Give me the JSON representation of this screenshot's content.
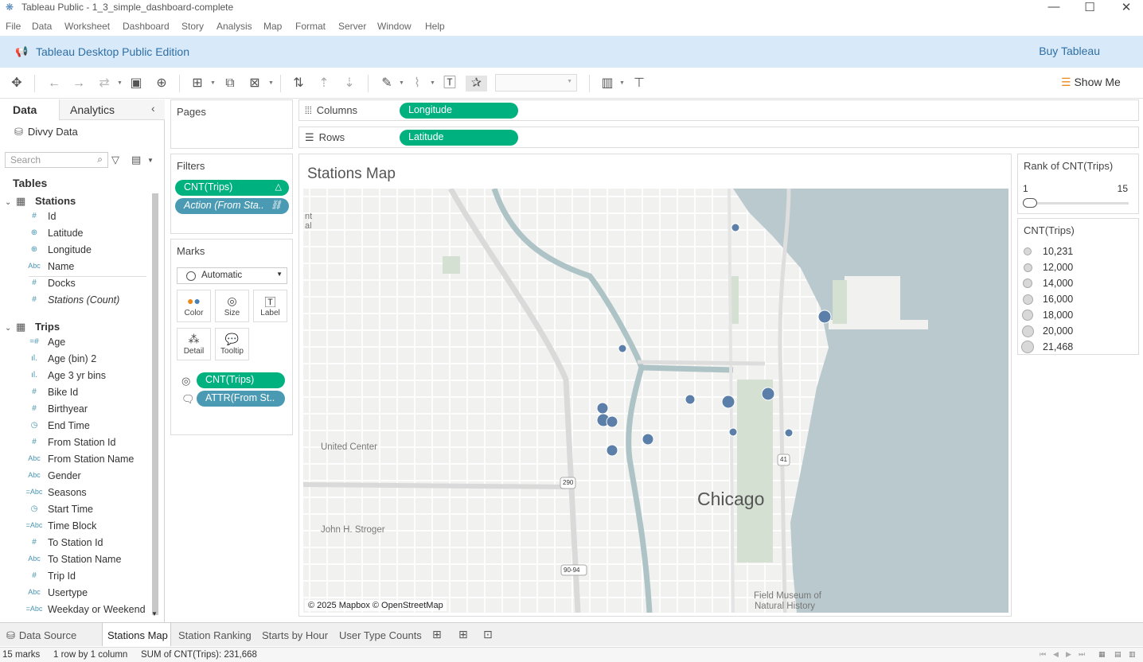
{
  "window": {
    "title": "Tableau Public - 1_3_simple_dashboard-complete",
    "min": "—",
    "max": "☐",
    "close": "✕"
  },
  "menu": [
    "File",
    "Data",
    "Worksheet",
    "Dashboard",
    "Story",
    "Analysis",
    "Map",
    "Format",
    "Server",
    "Window",
    "Help"
  ],
  "banner": {
    "title": "Tableau Desktop Public Edition",
    "buy": "Buy Tableau"
  },
  "toolbar": {
    "show_me": "Show Me"
  },
  "left_panel": {
    "tab_data": "Data",
    "tab_analytics": "Analytics",
    "datasource": "Divvy Data",
    "search_placeholder": "Search",
    "tables_heading": "Tables",
    "groups": [
      {
        "name": "Stations",
        "fields": [
          {
            "type": "#",
            "name": "Id"
          },
          {
            "type": "⊕",
            "name": "Latitude"
          },
          {
            "type": "⊕",
            "name": "Longitude"
          },
          {
            "type": "Abc",
            "name": "Name"
          },
          {
            "type": "#",
            "name": "Docks"
          },
          {
            "type": "#",
            "name": "Stations (Count)"
          }
        ]
      },
      {
        "name": "Trips",
        "fields": [
          {
            "type": "=#",
            "name": "Age"
          },
          {
            "type": "ıl.",
            "name": "Age (bin) 2"
          },
          {
            "type": "ıl.",
            "name": "Age 3 yr bins"
          },
          {
            "type": "#",
            "name": "Bike Id"
          },
          {
            "type": "#",
            "name": "Birthyear"
          },
          {
            "type": "◷",
            "name": "End Time"
          },
          {
            "type": "#",
            "name": "From Station Id"
          },
          {
            "type": "Abc",
            "name": "From Station Name"
          },
          {
            "type": "Abc",
            "name": "Gender"
          },
          {
            "type": "=Abc",
            "name": "Seasons"
          },
          {
            "type": "◷",
            "name": "Start Time"
          },
          {
            "type": "=Abc",
            "name": "Time Block"
          },
          {
            "type": "#",
            "name": "To Station Id"
          },
          {
            "type": "Abc",
            "name": "To Station Name"
          },
          {
            "type": "#",
            "name": "Trip Id"
          },
          {
            "type": "Abc",
            "name": "Usertype"
          },
          {
            "type": "=Abc",
            "name": "Weekday or Weekend"
          }
        ]
      }
    ]
  },
  "pages": {
    "title": "Pages"
  },
  "filters": {
    "title": "Filters",
    "pills": [
      "CNT(Trips)",
      "Action (From Sta.."
    ]
  },
  "marks": {
    "title": "Marks",
    "type": "Automatic",
    "buttons": [
      "Color",
      "Size",
      "Label",
      "Detail",
      "Tooltip"
    ],
    "pills": [
      "CNT(Trips)",
      "ATTR(From St.."
    ]
  },
  "shelves": {
    "columns_label": "Columns",
    "columns_pill": "Longitude",
    "rows_label": "Rows",
    "rows_pill": "Latitude"
  },
  "view": {
    "title": "Stations Map",
    "credit": "© 2025 Mapbox © OpenStreetMap",
    "labels": [
      "Chicago",
      "United Center",
      "John H. Stroger",
      "Field Museum of",
      "Natural History",
      "nt",
      "al",
      "290",
      "90-94",
      "41"
    ]
  },
  "rank_filter": {
    "title": "Rank of CNT(Trips)",
    "min": "1",
    "max": "15"
  },
  "size_legend": {
    "title": "CNT(Trips)",
    "items": [
      "10,231",
      "12,000",
      "14,000",
      "16,000",
      "18,000",
      "20,000",
      "21,468"
    ]
  },
  "map_points": [
    {
      "size_level": 1
    },
    {
      "size_level": 4
    },
    {
      "size_level": 1
    },
    {
      "size_level": 2
    },
    {
      "size_level": 4
    },
    {
      "size_level": 4
    },
    {
      "size_level": 3
    },
    {
      "size_level": 4
    },
    {
      "size_level": 3
    },
    {
      "size_level": 1
    },
    {
      "size_level": 3
    },
    {
      "size_level": 1
    },
    {
      "size_level": 3
    },
    {
      "size_level": 4
    }
  ],
  "sheets": {
    "data_source": "Data Source",
    "tabs": [
      "Stations Map",
      "Station Ranking",
      "Starts by Hour",
      "User Type Counts"
    ]
  },
  "status": {
    "marks": "15 marks",
    "layout": "1 row by 1 column",
    "sum": "SUM of CNT(Trips): 231,668"
  },
  "colors": {
    "pill_green": "#00b180",
    "pill_blue": "#4a9ab3",
    "mark": "#5b7fa8",
    "water": "#b9c9cd",
    "banner": "#d8eaf9"
  }
}
